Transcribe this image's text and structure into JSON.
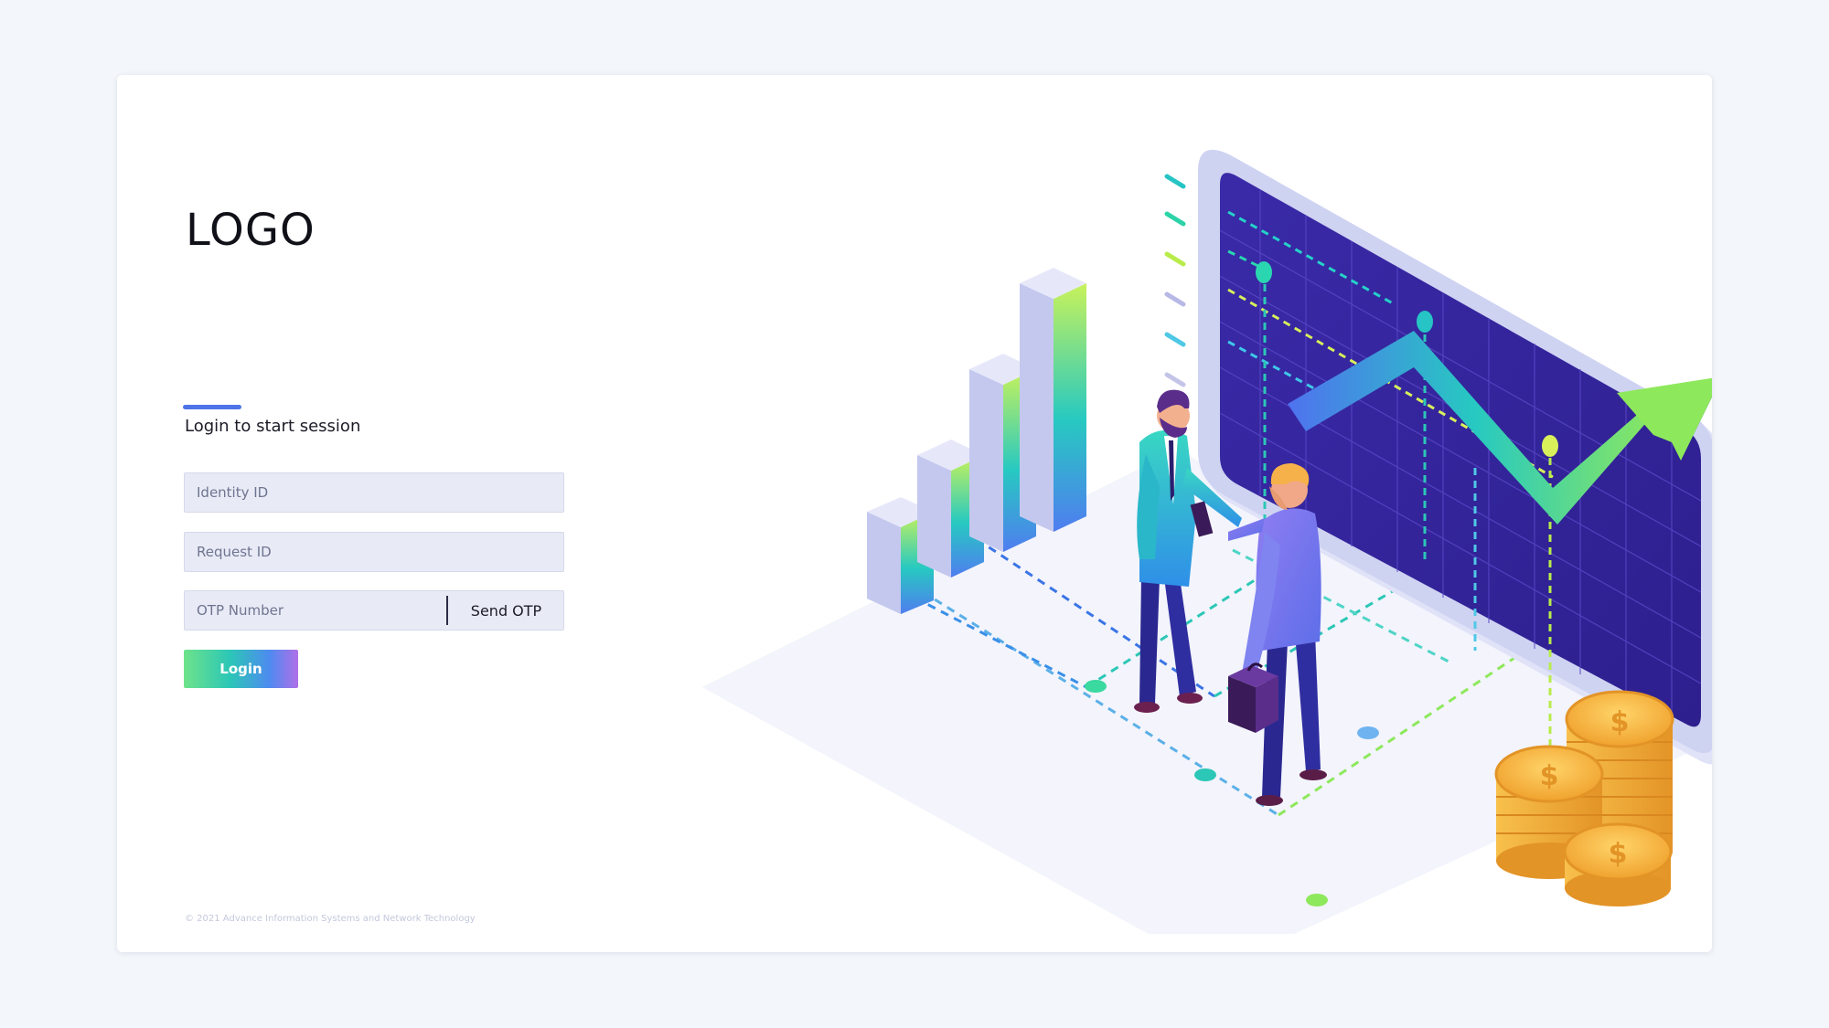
{
  "brand": {
    "logo_text": "LOGO"
  },
  "login_form": {
    "title": "Login to start session",
    "identity_placeholder": "Identity ID",
    "request_placeholder": "Request ID",
    "otp_placeholder": "OTP Number",
    "send_otp_label": "Send OTP",
    "login_label": "Login"
  },
  "footer": {
    "copyright": "© 2021 Advance Information Systems and Network Technology"
  },
  "illustration": {
    "coin_symbol": "$"
  },
  "colors": {
    "background": "#f3f6fa",
    "card": "#ffffff",
    "accent": "#4f73e8",
    "field_bg": "#e8eaf6",
    "screen": "#3a2aa8",
    "coin": "#f6b93b"
  }
}
